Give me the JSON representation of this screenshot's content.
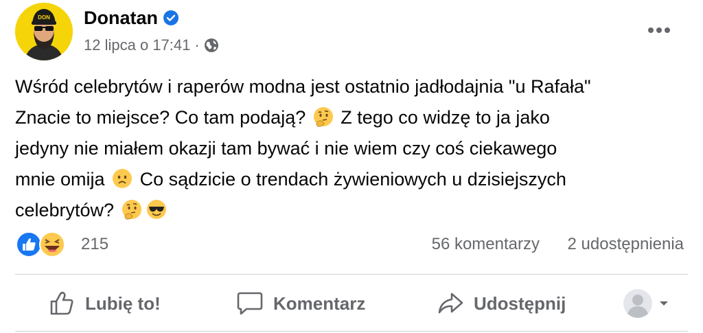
{
  "author": {
    "name": "Donatan",
    "verified_icon": "verified-badge-icon",
    "avatar_cap_text": "DON"
  },
  "meta": {
    "date": "12 lipca o 17:41",
    "separator": "·",
    "privacy_icon": "globe-icon"
  },
  "post": {
    "line1": "Wśród celebrytów i raperów modna jest ostatnio jadłodajnia \"u Rafała\"",
    "line2_a": "Znacie to miejsce? Co tam podają?",
    "line2_b": " Z tego co widzę to ja jako",
    "line3": "jedyny nie miałem okazji tam bywać i nie wiem czy coś ciekawego",
    "line4_a": "mnie omija",
    "line4_b": "  Co sądzicie o trendach żywieniowych u dzisiejszych",
    "line5_a": "celebrytów?",
    "emojis": [
      "thinking-face",
      "frowning-face",
      "thinking-face",
      "smiling-face-with-sunglasses"
    ]
  },
  "reactions": {
    "types": [
      "like",
      "haha"
    ],
    "count": "215",
    "comments": "56 komentarzy",
    "shares": "2 udostępnienia"
  },
  "actions": {
    "like_label": "Lubię to!",
    "comment_label": "Komentarz",
    "share_label": "Udostępnij"
  },
  "colors": {
    "secondary_text": "#65676b",
    "like_blue": "#1877f2",
    "verified_blue": "#1b74e4",
    "avatar_yellow": "#f6d40a",
    "emoji_yellow": "#fdc94e",
    "divider": "#ced0d4"
  }
}
